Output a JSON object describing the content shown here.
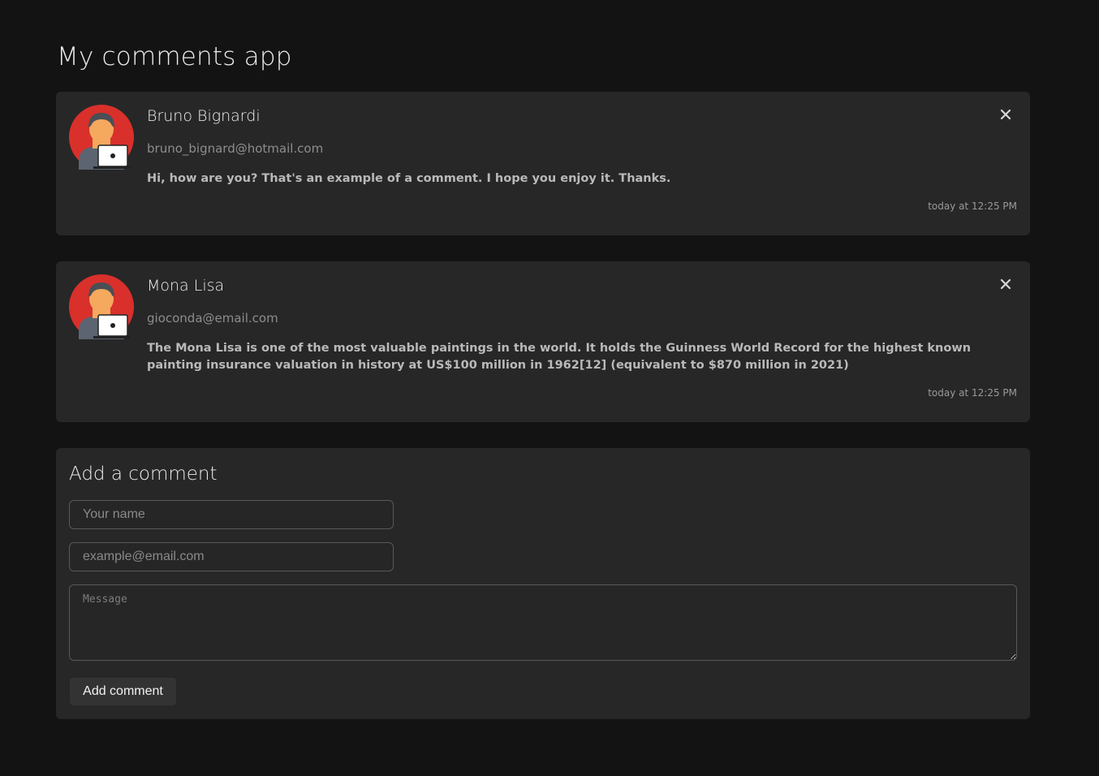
{
  "app": {
    "title": "My comments app"
  },
  "comments": [
    {
      "author": "Bruno Bignardi",
      "email": "bruno_bignard@hotmail.com",
      "message": "Hi, how are you? That's an example of a comment. I hope you enjoy it. Thanks.",
      "timestamp": "today at 12:25 PM",
      "avatar_icon": "person-with-laptop-icon",
      "close_icon": "close-icon"
    },
    {
      "author": "Mona Lisa",
      "email": "gioconda@email.com",
      "message": "The Mona Lisa is one of the most valuable paintings in the world. It holds the Guinness World Record for the highest known painting insurance valuation in history at US$100 million in 1962[12] (equivalent to $870 million in 2021)",
      "timestamp": "today at 12:25 PM",
      "avatar_icon": "person-with-laptop-icon",
      "close_icon": "close-icon"
    }
  ],
  "form": {
    "title": "Add a comment",
    "name_value": "",
    "name_placeholder": "Your name",
    "email_value": "",
    "email_placeholder": "example@email.com",
    "message_value": "",
    "message_placeholder": "Message",
    "submit_label": "Add comment"
  },
  "colors": {
    "background": "#131313",
    "card": "#272727",
    "avatar_circle": "#d9302b",
    "skin": "#f4a95e",
    "hair": "#4a4f55"
  }
}
